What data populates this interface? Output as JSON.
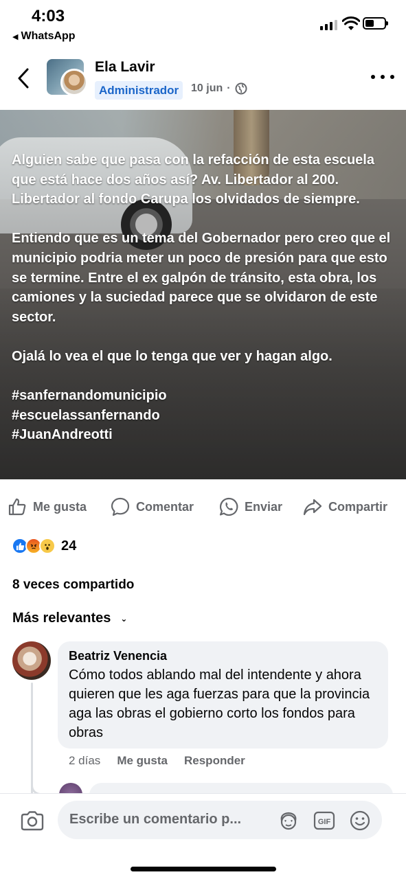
{
  "status_bar": {
    "time": "4:03",
    "back_app": "WhatsApp"
  },
  "post": {
    "author": "Ela Lavir",
    "badge": "Administrador",
    "date": "10 jun",
    "separator": "·",
    "paragraphs": [
      "Alguien sabe que pasa con la refacción de esta escuela que está hace dos años así? Av. Libertador al 200. Libertador al fondo Carupa los olvidados de siempre.",
      "Entiendo que es un tema del Gobernador pero creo que el municipio podria meter un poco de presión para que esto se termine. Entre el ex galpón de tránsito, esta obra, los camiones y la suciedad parece que se olvidaron de este sector.",
      "Ojalá lo vea el que lo tenga que ver y hagan algo."
    ],
    "hashtags": [
      "#sanfernandomunicipio",
      "#escuelassanfernando",
      "#JuanAndreotti"
    ]
  },
  "actions": {
    "like": "Me gusta",
    "comment": "Comentar",
    "send": "Enviar",
    "share": "Compartir"
  },
  "reactions": {
    "count": "24",
    "types": [
      "like",
      "angry",
      "wow"
    ]
  },
  "shares_text": "8 veces compartido",
  "sort_label": "Más relevantes",
  "comment": {
    "author": "Beatriz Venencia",
    "text": "Cómo todos ablando mal del intendente y ahora quieren que les aga fuerzas para que la provincia aga las obras el gobierno corto los fondos para obras",
    "age": "2 días",
    "like": "Me gusta",
    "reply": "Responder"
  },
  "composer": {
    "placeholder": "Escribe un comentario p...",
    "gif_label": "GIF"
  },
  "colors": {
    "accent_blue": "#1877f2",
    "badge_bg": "#e7f0fd",
    "badge_text": "#1b66c9",
    "secondary_text": "#65676b",
    "bubble_bg": "#f0f2f5"
  }
}
